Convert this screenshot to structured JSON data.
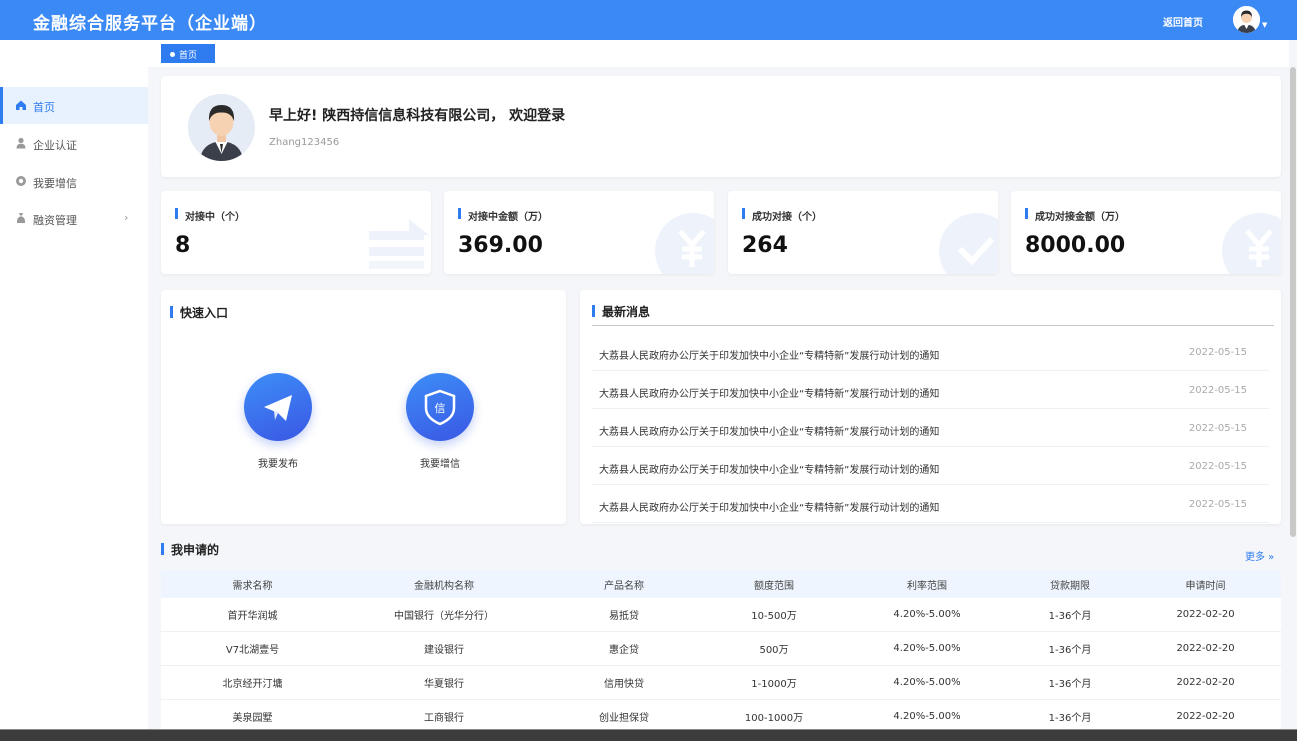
{
  "header": {
    "title": "金融综合服务平台（企业端）",
    "home_link": "返回首页"
  },
  "sidebar": {
    "items": [
      {
        "label": "首页",
        "icon": "home-icon",
        "active": true
      },
      {
        "label": "企业认证",
        "icon": "user-icon"
      },
      {
        "label": "我要增信",
        "icon": "credit-icon"
      },
      {
        "label": "融资管理",
        "icon": "finance-icon"
      }
    ]
  },
  "breadcrumb": {
    "label": "首页"
  },
  "welcome": {
    "greeting": "早上好!  陕西持信信息科技有限公司，  欢迎登录",
    "username": "Zhang123456"
  },
  "stats": [
    {
      "label": "对接中（个）",
      "value": "8",
      "icon": "transfer-icon"
    },
    {
      "label": "对接中金额（万）",
      "value": "369.00",
      "icon": "yuan-icon"
    },
    {
      "label": "成功对接（个）",
      "value": "264",
      "icon": "check-icon"
    },
    {
      "label": "成功对接金额（万）",
      "value": "8000.00",
      "icon": "yuan-icon"
    }
  ],
  "quick_entry": {
    "title": "快速入口",
    "buttons": [
      {
        "label": "我要发布",
        "icon": "paper-plane-icon"
      },
      {
        "label": "我要增信",
        "icon": "credit-shield-icon",
        "glyph": "信"
      }
    ]
  },
  "news": {
    "title": "最新消息",
    "items": [
      {
        "title": "大荔县人民政府办公厅关于印发加快中小企业“专精特新”发展行动计划的通知",
        "date": "2022-05-15"
      },
      {
        "title": "大荔县人民政府办公厅关于印发加快中小企业“专精特新”发展行动计划的通知",
        "date": "2022-05-15"
      },
      {
        "title": "大荔县人民政府办公厅关于印发加快中小企业“专精特新”发展行动计划的通知",
        "date": "2022-05-15"
      },
      {
        "title": "大荔县人民政府办公厅关于印发加快中小企业“专精特新”发展行动计划的通知",
        "date": "2022-05-15"
      },
      {
        "title": "大荔县人民政府办公厅关于印发加快中小企业“专精特新”发展行动计划的通知",
        "date": "2022-05-15"
      }
    ]
  },
  "applications": {
    "title": "我申请的",
    "more": "更多 »",
    "columns": [
      "需求名称",
      "金融机构名称",
      "产品名称",
      "额度范围",
      "利率范围",
      "贷款期限",
      "申请时间"
    ],
    "rows": [
      [
        "首开华润城",
        "中国银行（光华分行）",
        "易抵贷",
        "10-500万",
        "4.20%-5.00%",
        "1-36个月",
        "2022-02-20"
      ],
      [
        "V7北湖壹号",
        "建设银行",
        "惠企贷",
        "500万",
        "4.20%-5.00%",
        "1-36个月",
        "2022-02-20"
      ],
      [
        "北京经开汀墉",
        "华夏银行",
        "信用快贷",
        "1-1000万",
        "4.20%-5.00%",
        "1-36个月",
        "2022-02-20"
      ],
      [
        "美泉园墅",
        "工商银行",
        "创业担保贷",
        "100-1000万",
        "4.20%-5.00%",
        "1-36个月",
        "2022-02-20"
      ]
    ]
  },
  "colors": {
    "primary": "#3b89f5",
    "accent": "#2f7cf0",
    "active_bg": "#e8f1fe"
  }
}
